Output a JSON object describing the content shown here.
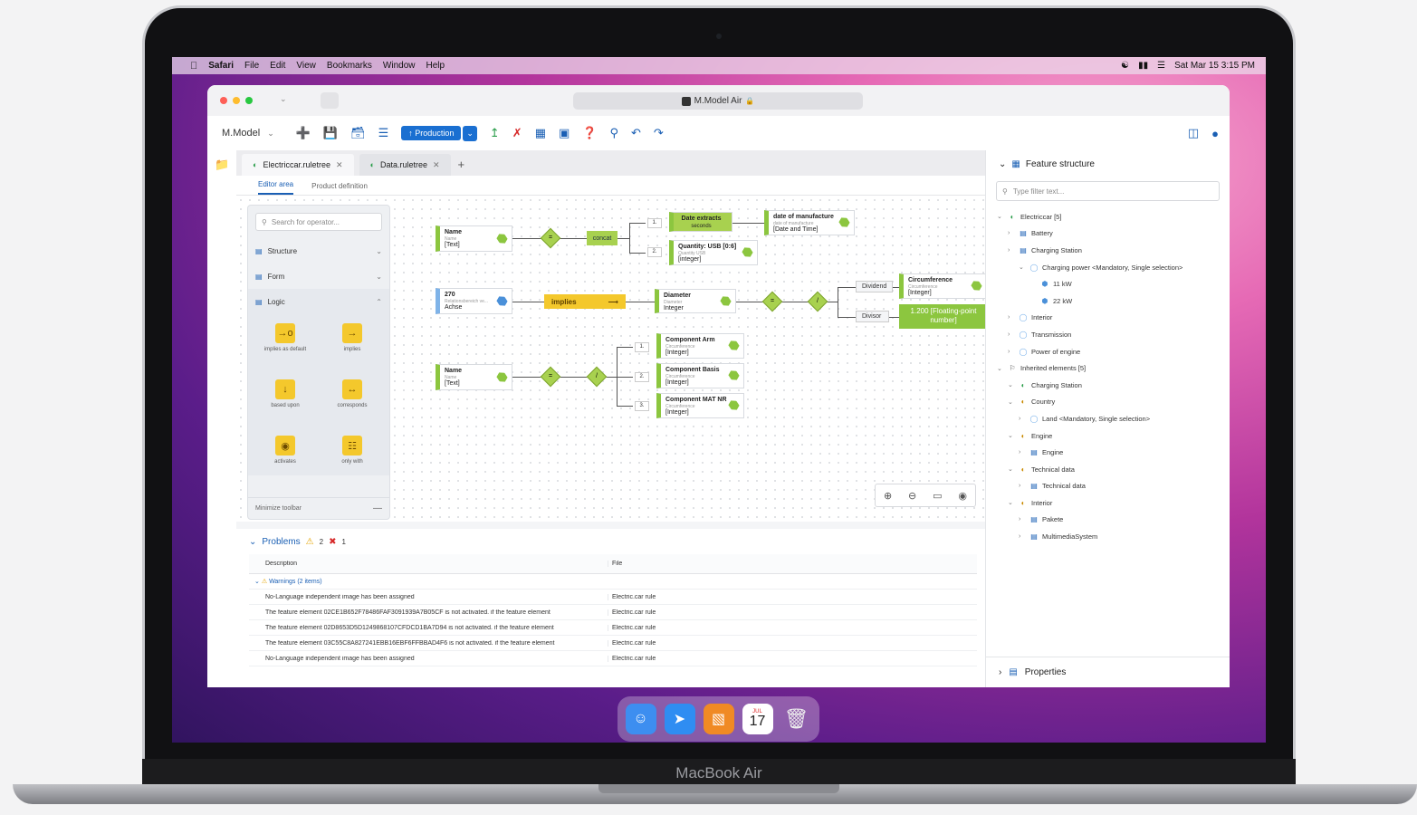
{
  "menubar": {
    "items": [
      "Safari",
      "File",
      "Edit",
      "View",
      "Bookmarks",
      "Window",
      "Help"
    ],
    "datetime": "Sat Mar 15  3:15 PM"
  },
  "browser": {
    "url_title": "M.Model Air"
  },
  "toolbar": {
    "app_name": "M.Model",
    "production_label": "Production"
  },
  "tabs": [
    {
      "label": "Electriccar.ruletree"
    },
    {
      "label": "Data.ruletree"
    }
  ],
  "subtabs": [
    "Editor area",
    "Product definition"
  ],
  "palette": {
    "search_placeholder": "Search for operator...",
    "groups": [
      "Structure",
      "Form",
      "Logic"
    ],
    "operators": [
      "implies as default",
      "implies",
      "based upon",
      "corresponds",
      "activates",
      "only with"
    ],
    "minimize_label": "Minimize toolbar"
  },
  "diagram": {
    "row1": {
      "name_title": "Name",
      "name_sub": "Name",
      "name_type": "[Text]",
      "eq": "=",
      "concat": "concat",
      "idx1": "1.",
      "idx2": "2.",
      "date_extracts": "Date extracts",
      "date_extracts_sub": "seconds",
      "quantity_title": "Quantity: USB [0:6]",
      "quantity_sub": "Quantity USB",
      "quantity_type": "[integer]",
      "manufacture_title": "date of manufacture",
      "manufacture_sub": "date of manufacture",
      "manufacture_type": "[Date and Time]"
    },
    "row2": {
      "num_title": "270",
      "num_sub": "Relationsbereich ve...",
      "num_type": "Achse",
      "implies": "implies",
      "diameter_title": "Diameter",
      "diameter_sub": "Diameter",
      "diameter_type": "Integer",
      "eq": "=",
      "div": "/",
      "dividend": "Dividend",
      "divisor": "Divisor",
      "circ_title": "Circumference",
      "circ_sub": "Circumference",
      "circ_type": "[Integer]",
      "float_value": "1.200 [Floating-point number]"
    },
    "row3": {
      "name_title": "Name",
      "name_sub": "Name",
      "name_type": "[Text]",
      "eq": "=",
      "div": "/",
      "idx1": "1.",
      "idx2": "2.",
      "idx3": "3.",
      "c1_title": "Component Arm",
      "c1_sub": "Circumference",
      "c1_type": "[Integer]",
      "c2_title": "Component Basis",
      "c2_sub": "Circumference",
      "c2_type": "[Integer]",
      "c3_title": "Component MAT NR",
      "c3_sub": "Circumference",
      "c3_type": "[Integer]"
    }
  },
  "problems": {
    "title": "Problems",
    "warning_count": "2",
    "error_count": "1",
    "col_description": "Description",
    "col_file": "File",
    "group_label": "Warnings (2 items)",
    "rows": [
      {
        "desc": "No-Language independent image has been assigned",
        "file": "Electric.car rule"
      },
      {
        "desc": "The feature element 02CE1B652F78486FAF3091939A7B05CF is not activated. if the feature element",
        "file": "Electric.car rule"
      },
      {
        "desc": "The feature element 02D8653D5D1249868107CFDCD1BA7D94 is not activated. if the feature element",
        "file": "Electric.car rule"
      },
      {
        "desc": "The feature element 03C55C8A827241EBB16EBF6FFBBAD4F6 is not activated. if the feature element",
        "file": "Electric.car rule"
      },
      {
        "desc": "No-Language independent image has been assigned",
        "file": "Electric.car rule"
      }
    ]
  },
  "feature_structure": {
    "title": "Feature structure",
    "filter_placeholder": "Type filter text...",
    "tree": [
      {
        "label": "Electriccar [5]",
        "depth": 0,
        "open": true,
        "icon": "feature"
      },
      {
        "label": "Battery",
        "depth": 1,
        "open": false,
        "icon": "folder"
      },
      {
        "label": "Charging Station",
        "depth": 1,
        "open": false,
        "icon": "folder"
      },
      {
        "label": "Charging power <Mandatory, Single selection>",
        "depth": 2,
        "open": true,
        "icon": "option"
      },
      {
        "label": "11 kW",
        "depth": 3,
        "open": null,
        "icon": "value"
      },
      {
        "label": "22 kW",
        "depth": 3,
        "open": null,
        "icon": "value"
      },
      {
        "label": "Interior",
        "depth": 1,
        "open": false,
        "icon": "option"
      },
      {
        "label": "Transmission",
        "depth": 1,
        "open": false,
        "icon": "option"
      },
      {
        "label": "Power of engine",
        "depth": 1,
        "open": false,
        "icon": "option"
      },
      {
        "label": "Inherited elements [5]",
        "depth": 0,
        "open": true,
        "icon": "inherited"
      },
      {
        "label": "Charging Station",
        "depth": 1,
        "open": true,
        "icon": "feature"
      },
      {
        "label": "Country",
        "depth": 1,
        "open": true,
        "icon": "feature-y"
      },
      {
        "label": "Land <Mandatory, Single selection>",
        "depth": 2,
        "open": false,
        "icon": "option"
      },
      {
        "label": "Engine",
        "depth": 1,
        "open": true,
        "icon": "feature-y"
      },
      {
        "label": "Engine",
        "depth": 2,
        "open": false,
        "icon": "folder"
      },
      {
        "label": "Technical data",
        "depth": 1,
        "open": true,
        "icon": "feature-y"
      },
      {
        "label": "Technical data",
        "depth": 2,
        "open": false,
        "icon": "folder"
      },
      {
        "label": "Interior",
        "depth": 1,
        "open": true,
        "icon": "feature-y"
      },
      {
        "label": "Pakete",
        "depth": 2,
        "open": false,
        "icon": "folder"
      },
      {
        "label": "MultimediaSystem",
        "depth": 2,
        "open": false,
        "icon": "folder"
      }
    ]
  },
  "properties": {
    "title": "Properties"
  },
  "dock": {
    "calendar_month": "JUL",
    "calendar_day": "17"
  },
  "laptop_label": "MacBook Air",
  "colors": {
    "accent": "#1a6fd1",
    "green": "#8cc63f",
    "yellow": "#f4c82c",
    "warning": "#e5a400",
    "error": "#d62828"
  }
}
